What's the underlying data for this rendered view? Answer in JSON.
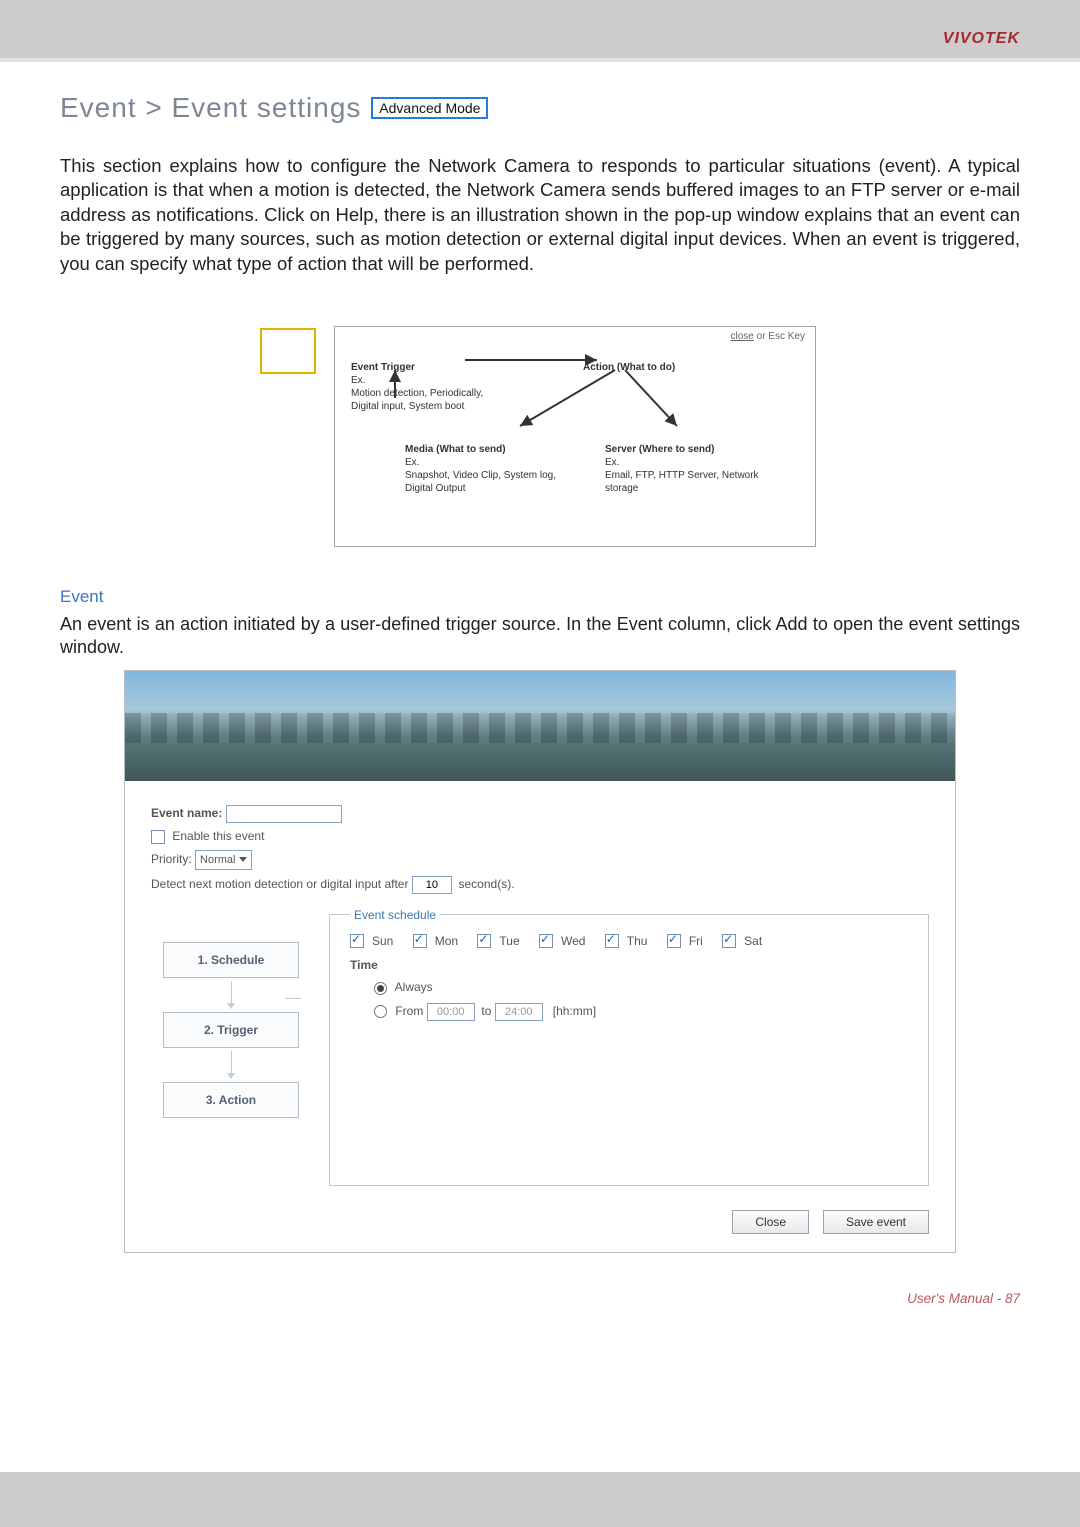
{
  "brand": "VIVOTEK",
  "breadcrumb": "Event > Event settings",
  "advanced_badge": "Advanced Mode",
  "intro": "This section explains how to configure the Network Camera to responds to particular situations (event). A typical application is that when a motion is detected, the Network Camera sends buffered images to an FTP server or e-mail address as notifications. Click on Help, there is an illustration shown in the pop-up window explains that an event can be triggered by many sources, such as motion detection or external digital input devices. When an event is triggered, you can specify what type of action that will be performed.",
  "diagram": {
    "close_text_a": "close",
    "close_text_b": " or Esc Key",
    "trigger": {
      "title": "Event Trigger",
      "ex": "Ex.",
      "desc": "Motion detection, Periodically, Digital input, System boot"
    },
    "action": {
      "title": "Action (What to do)"
    },
    "media": {
      "title": "Media (What to send)",
      "ex": "Ex.",
      "desc": "Snapshot, Video Clip, System log, Digital Output"
    },
    "server": {
      "title": "Server (Where to send)",
      "ex": "Ex.",
      "desc": "Email, FTP, HTTP Server, Network storage"
    }
  },
  "event_section": {
    "heading": "Event",
    "desc": "An event is an action initiated by a user-defined trigger source. In the Event column, click Add to open the event settings window."
  },
  "form": {
    "event_name_label": "Event name:",
    "event_name_value": "",
    "enable_label": "Enable this event",
    "enable_checked": false,
    "priority_label": "Priority:",
    "priority_value": "Normal",
    "detect_label_a": "Detect next motion detection or digital input after",
    "detect_value": "10",
    "detect_label_b": "second(s).",
    "steps": [
      "1.  Schedule",
      "2.  Trigger",
      "3.  Action"
    ],
    "schedule_legend": "Event schedule",
    "days": [
      "Sun",
      "Mon",
      "Tue",
      "Wed",
      "Thu",
      "Fri",
      "Sat"
    ],
    "days_checked": [
      true,
      true,
      true,
      true,
      true,
      true,
      true
    ],
    "time_label": "Time",
    "time_always": "Always",
    "time_from": "From",
    "time_from_value": "00:00",
    "time_to": "to",
    "time_to_value": "24:00",
    "time_hint": "[hh:mm]",
    "close_btn": "Close",
    "save_btn": "Save event"
  },
  "footer": "User's Manual - 87"
}
